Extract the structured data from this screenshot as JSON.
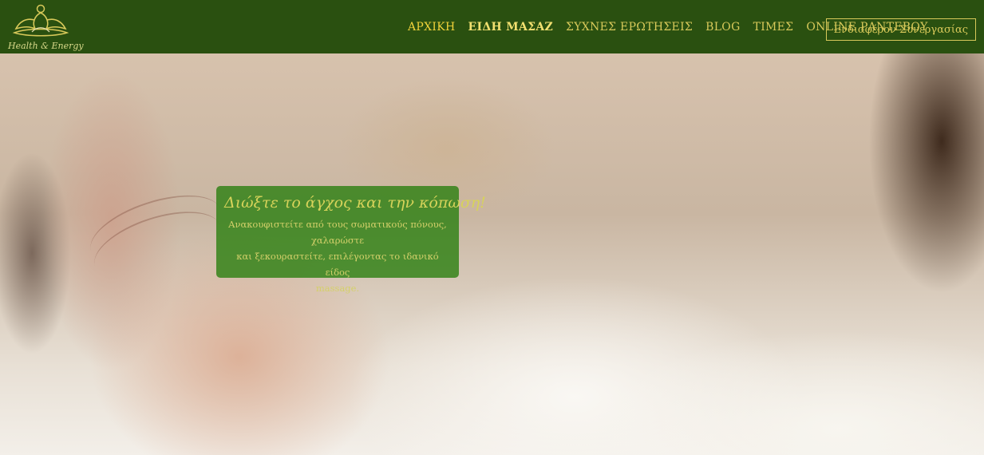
{
  "header": {
    "logo_text": "Health & Energy",
    "nav": [
      "ΑΡΧΙΚΗ",
      "ΕΙΔΗ ΜΑΣΑΖ",
      "ΣΥΧΝΕΣ ΕΡΩΤΗΣΕΙΣ",
      "BLOG",
      "ΤΙΜΕΣ",
      "ONLINE ΡΑΝΤΕΒΟΥ"
    ],
    "cta": "Ενδιαφέρον Συνεργασίας"
  },
  "hero": {
    "title": "Διώξτε το άγχος και την κόπωση!",
    "text_line1": "Ανακουφιστείτε από τους σωματικούς πόνους, χαλαρώστε",
    "text_line2": "και  ξεκουραστείτε, επιλέγοντας  το ιδανικό είδος",
    "text_line3": "massage."
  },
  "colors": {
    "header_bg": "#2a5010",
    "nav_text": "#d8c95a",
    "card_bg": "#267d0c",
    "card_text": "#d7d35a"
  }
}
